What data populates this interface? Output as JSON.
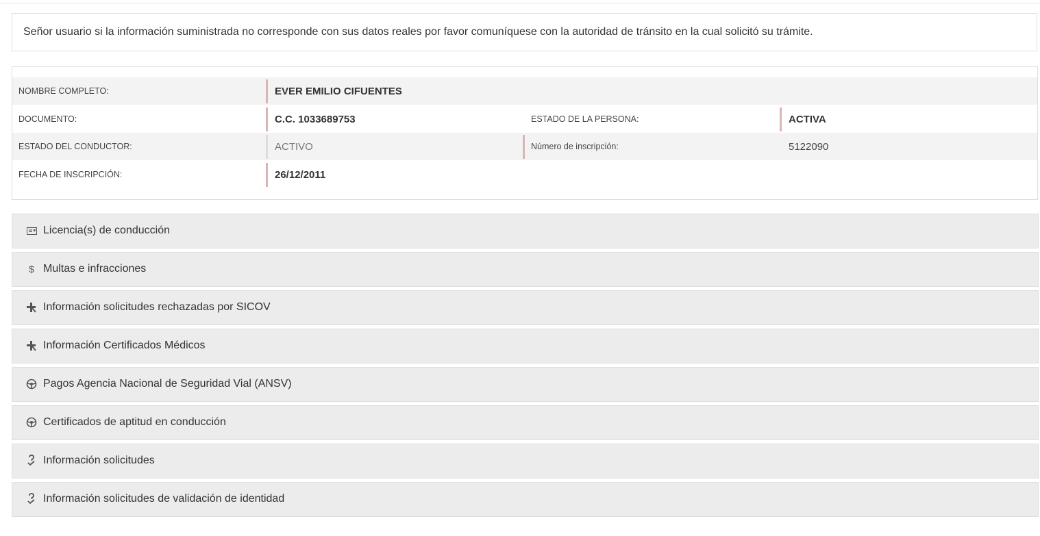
{
  "notice": {
    "text": "Señor usuario si la información suministrada no corresponde con sus datos reales por favor comuníquese con la autoridad de tránsito en la cual solicitó su trámite."
  },
  "person": {
    "name_label": "NOMBRE COMPLETO:",
    "name_value": "EVER EMILIO CIFUENTES",
    "document_label": "DOCUMENTO:",
    "document_value": "C.C. 1033689753",
    "person_state_label": "ESTADO DE LA PERSONA:",
    "person_state_value": "ACTIVA",
    "driver_state_label": "ESTADO DEL CONDUCTOR:",
    "driver_state_value": "ACTIVO",
    "registration_number_label": "Número de inscripción:",
    "registration_number_value": "5122090",
    "registration_date_label": "FECHA DE INSCRIPCIÓN:",
    "registration_date_value": "26/12/2011"
  },
  "sections": [
    {
      "label": "Licencia(s) de conducción",
      "icon": "id-card-icon"
    },
    {
      "label": "Multas e infracciones",
      "icon": "dollar-icon"
    },
    {
      "label": "Información solicitudes rechazadas por SICOV",
      "icon": "plus-slash-icon"
    },
    {
      "label": "Información Certificados Médicos",
      "icon": "plus-slash-icon"
    },
    {
      "label": "Pagos Agencia Nacional de Seguridad Vial (ANSV)",
      "icon": "steering-wheel-icon"
    },
    {
      "label": "Certificados de aptitud en conducción",
      "icon": "steering-wheel-icon"
    },
    {
      "label": "Información solicitudes",
      "icon": "question-check-icon"
    },
    {
      "label": "Información solicitudes de validación de identidad",
      "icon": "question-check-icon"
    }
  ],
  "colors": {
    "accent_border": "#d9b5b5",
    "section_background": "#ececec"
  }
}
